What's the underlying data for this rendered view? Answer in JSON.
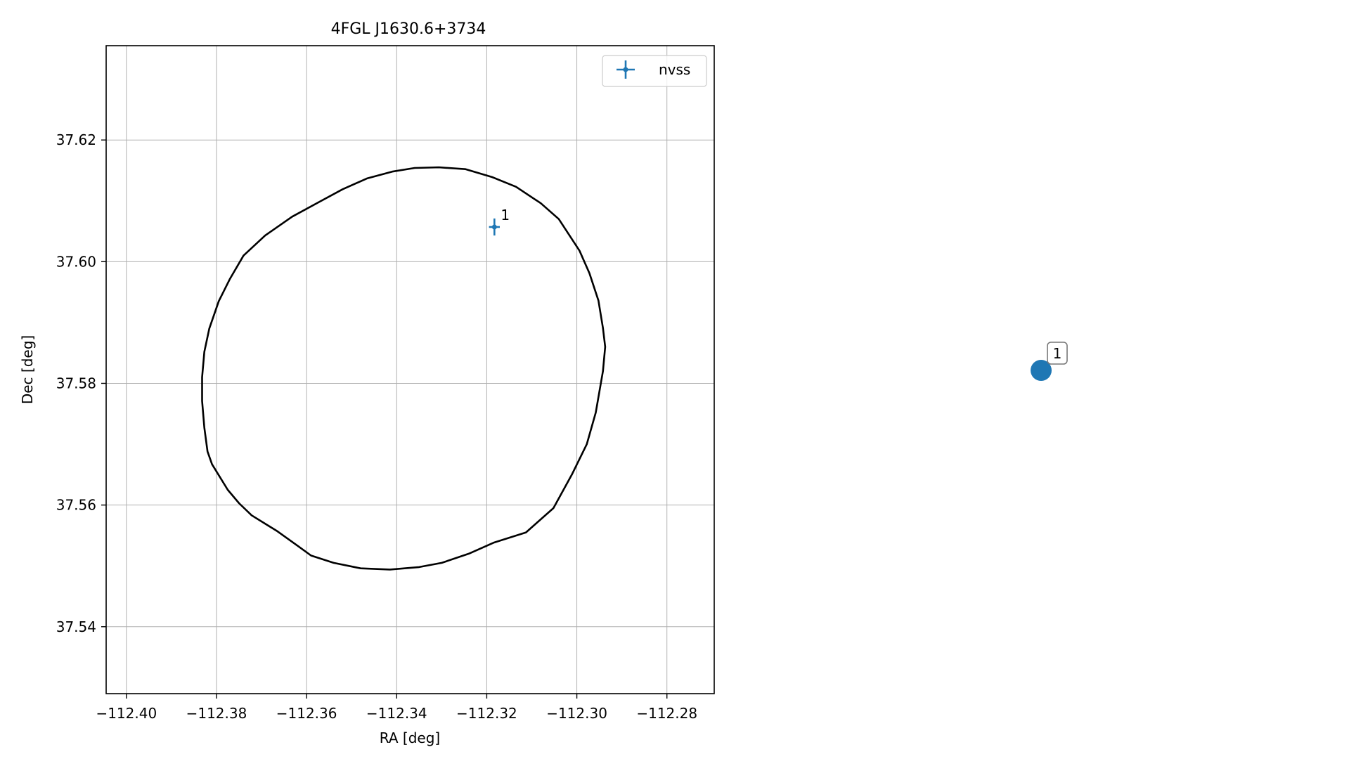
{
  "chart_data": [
    {
      "type": "scatter",
      "title": "4FGL J1630.6+3734",
      "xlabel": "RA [deg]",
      "ylabel": "Dec [deg]",
      "xlim": [
        -112.4045,
        -112.2695
      ],
      "ylim": [
        37.529,
        37.6355
      ],
      "x_ticks": [
        -112.4,
        -112.38,
        -112.36,
        -112.34,
        -112.32,
        -112.3,
        -112.28
      ],
      "x_tick_labels": [
        "−112.40",
        "−112.38",
        "−112.36",
        "−112.34",
        "−112.32",
        "−112.30",
        "−112.28"
      ],
      "y_ticks": [
        37.54,
        37.56,
        37.58,
        37.6,
        37.62
      ],
      "y_tick_labels": [
        "37.54",
        "37.56",
        "37.58",
        "37.60",
        "37.62"
      ],
      "grid": true,
      "legend_position": "top-right",
      "series": [
        {
          "name": "nvss",
          "type": "errorbar",
          "color": "#1f77b4",
          "points": [
            {
              "x": -112.3183,
              "y": 37.6057,
              "xerr": 0.0012,
              "yerr": 0.0014,
              "label": "1"
            }
          ]
        }
      ],
      "ellipse": {
        "color": "#000000",
        "points": [
          [
            -112.3306,
            37.6155
          ],
          [
            -112.3247,
            37.6152
          ],
          [
            -112.3188,
            37.6139
          ],
          [
            -112.3135,
            37.6123
          ],
          [
            -112.308,
            37.6096
          ],
          [
            -112.304,
            37.607
          ],
          [
            -112.2994,
            37.6018
          ],
          [
            -112.2972,
            37.5981
          ],
          [
            -112.2952,
            37.5936
          ],
          [
            -112.2942,
            37.5891
          ],
          [
            -112.2937,
            37.586
          ],
          [
            -112.2942,
            37.582
          ],
          [
            -112.2958,
            37.5752
          ],
          [
            -112.2978,
            37.57
          ],
          [
            -112.3011,
            37.565
          ],
          [
            -112.3052,
            37.5595
          ],
          [
            -112.3113,
            37.5555
          ],
          [
            -112.3185,
            37.5538
          ],
          [
            -112.324,
            37.552
          ],
          [
            -112.33,
            37.5505
          ],
          [
            -112.335,
            37.5498
          ],
          [
            -112.3415,
            37.5494
          ],
          [
            -112.348,
            37.5496
          ],
          [
            -112.354,
            37.5505
          ],
          [
            -112.359,
            37.5517
          ],
          [
            -112.362,
            37.5533
          ],
          [
            -112.3665,
            37.5557
          ],
          [
            -112.3722,
            37.5583
          ],
          [
            -112.375,
            37.5603
          ],
          [
            -112.3775,
            37.5625
          ],
          [
            -112.381,
            37.5667
          ],
          [
            -112.382,
            37.5688
          ],
          [
            -112.3827,
            37.5727
          ],
          [
            -112.3832,
            37.5771
          ],
          [
            -112.3832,
            37.581
          ],
          [
            -112.3827,
            37.5852
          ],
          [
            -112.3816,
            37.589
          ],
          [
            -112.3795,
            37.5935
          ],
          [
            -112.377,
            37.5972
          ],
          [
            -112.374,
            37.601
          ],
          [
            -112.3692,
            37.6043
          ],
          [
            -112.3632,
            37.6074
          ],
          [
            -112.357,
            37.6099
          ],
          [
            -112.352,
            37.6119
          ],
          [
            -112.3465,
            37.6137
          ],
          [
            -112.341,
            37.6148
          ],
          [
            -112.336,
            37.6154
          ],
          [
            -112.3306,
            37.6155
          ]
        ]
      }
    },
    {
      "type": "scatter",
      "series": [
        {
          "color": "#1f77b4",
          "points": [
            {
              "label": "1"
            }
          ]
        }
      ]
    }
  ]
}
